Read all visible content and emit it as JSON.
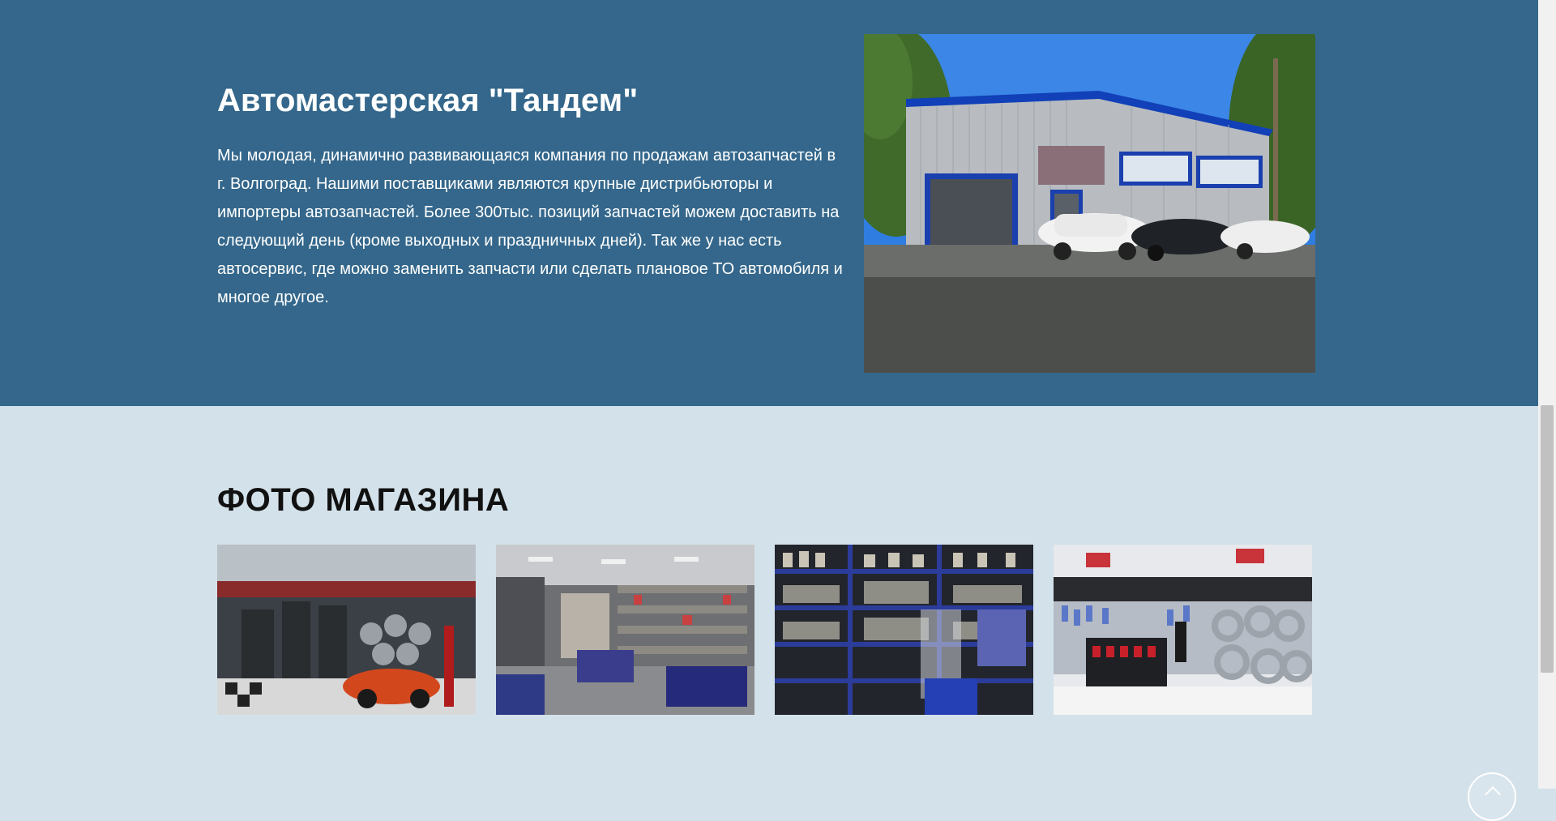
{
  "about": {
    "title": "Автомастерская \"Тандем\"",
    "description": "Мы молодая, динамично развивающаяся компания по продажам автозапчастей в г. Волгоград. Нашими поставщиками являются крупные дистрибьюторы и импортеры автозапчастей. Более 300тыс. позиций запчастей можем доставить на следующий день (кроме выходных и праздничных дней). Так же у нас есть автосервис, где можно заменить запчасти или сделать плановое ТО автомобиля и многое другое."
  },
  "gallery": {
    "title": "ФОТО МАГАЗИНА",
    "photos": [
      {
        "name": "store-photo-1"
      },
      {
        "name": "store-photo-2"
      },
      {
        "name": "store-photo-3"
      },
      {
        "name": "store-photo-4"
      }
    ]
  },
  "colors": {
    "about_bg": "#34678b",
    "gallery_bg": "#d3e1ea",
    "title_dark": "#111111",
    "text_light": "#ffffff"
  },
  "icons": {
    "scroll_top": "chevron-up-icon"
  }
}
